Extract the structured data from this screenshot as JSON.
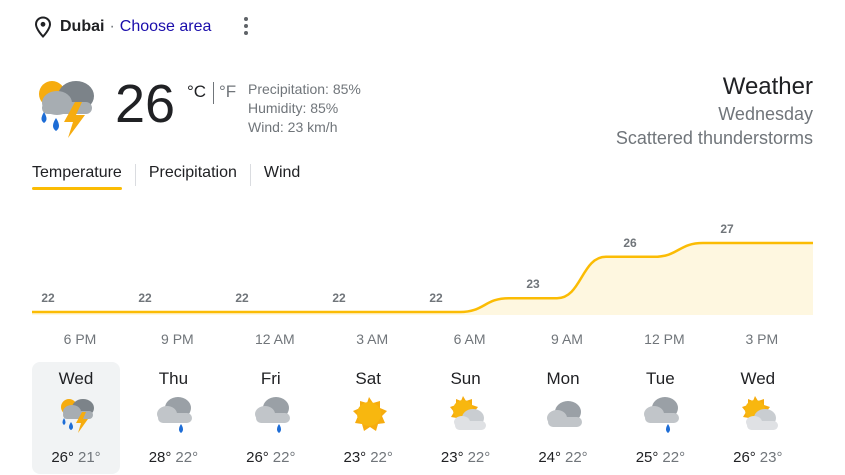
{
  "location": {
    "city": "Dubai",
    "separator": "·",
    "choose_area": "Choose area"
  },
  "current": {
    "temperature": "26",
    "unit_c": "°C",
    "unit_f": "°F",
    "precipitation": "Precipitation: 85%",
    "humidity": "Humidity: 85%",
    "wind": "Wind: 23 km/h",
    "icon": "rain-thunder-icon"
  },
  "header": {
    "title": "Weather",
    "day": "Wednesday",
    "condition": "Scattered thunderstorms"
  },
  "tabs": [
    {
      "label": "Temperature"
    },
    {
      "label": "Precipitation"
    },
    {
      "label": "Wind"
    }
  ],
  "chart_data": {
    "type": "area",
    "x": [
      "6 PM",
      "9 PM",
      "12 AM",
      "3 AM",
      "6 AM",
      "9 AM",
      "12 PM",
      "3 PM"
    ],
    "values": [
      22,
      22,
      22,
      22,
      22,
      23,
      26,
      27
    ],
    "color": "#fbbc04",
    "fill": "#fef7e0"
  },
  "hours": [
    "6 PM",
    "9 PM",
    "12 AM",
    "3 AM",
    "6 AM",
    "9 AM",
    "12 PM",
    "3 PM"
  ],
  "forecast": [
    {
      "day": "Wed",
      "high": "26°",
      "low": "21°",
      "icon": "rain-thunder-icon"
    },
    {
      "day": "Thu",
      "high": "28°",
      "low": "22°",
      "icon": "rain-cloud-icon"
    },
    {
      "day": "Fri",
      "high": "26°",
      "low": "22°",
      "icon": "rain-cloud-icon"
    },
    {
      "day": "Sat",
      "high": "23°",
      "low": "22°",
      "icon": "sun-icon"
    },
    {
      "day": "Sun",
      "high": "23°",
      "low": "22°",
      "icon": "partly-cloudy-icon"
    },
    {
      "day": "Mon",
      "high": "24°",
      "low": "22°",
      "icon": "cloud-icon"
    },
    {
      "day": "Tue",
      "high": "25°",
      "low": "22°",
      "icon": "rain-cloud-icon"
    },
    {
      "day": "Wed",
      "high": "26°",
      "low": "23°",
      "icon": "partly-cloudy-icon"
    }
  ]
}
